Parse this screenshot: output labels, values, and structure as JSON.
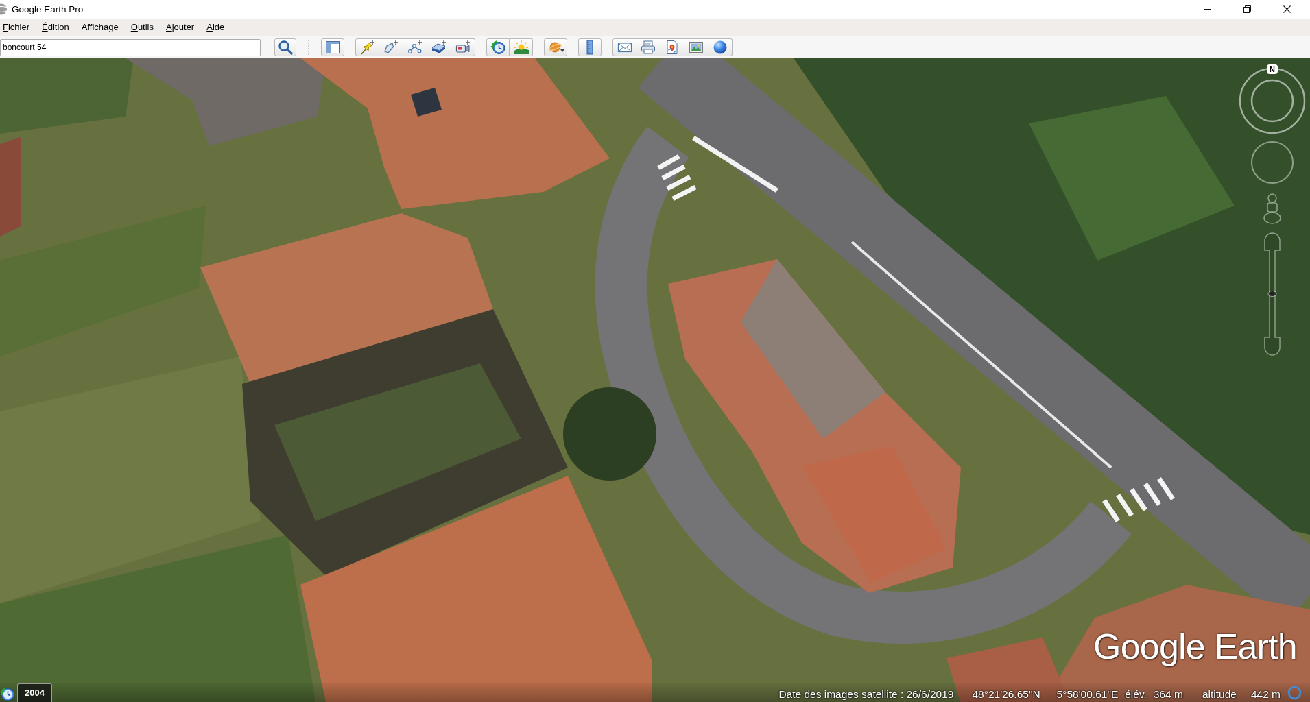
{
  "window": {
    "title": "Google Earth Pro"
  },
  "menu_bar": [
    {
      "label": "Fichier",
      "underlined_initial": true
    },
    {
      "label": "Édition",
      "underlined_initial": true
    },
    {
      "label": "Affichage",
      "underlined_initial": false
    },
    {
      "label": "Outils",
      "underlined_initial": true
    },
    {
      "label": "Ajouter",
      "underlined_initial": true
    },
    {
      "label": "Aide",
      "underlined_initial": true
    }
  ],
  "toolbar": {
    "search": {
      "value": "boncourt 54"
    }
  },
  "map": {
    "compass": {
      "label": "N"
    },
    "zoom_slider": {
      "level": 0.5
    },
    "imagery_year": "2004",
    "logo": "Google Earth"
  },
  "status_bar": {
    "imagery_date": "Date des images satellite : 26/6/2019",
    "latitude": "48°21'26.65\"N",
    "longitude": "5°58'00.61\"E",
    "elevation_label": "élév.",
    "elevation": "364 m",
    "altitude_label": "altitude",
    "altitude": "442 m"
  }
}
